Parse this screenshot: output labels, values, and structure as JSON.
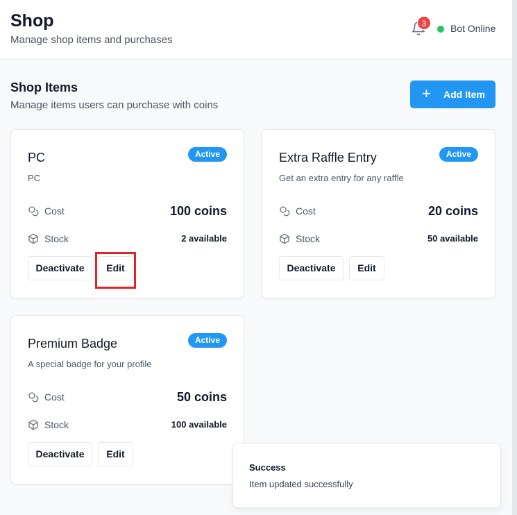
{
  "header": {
    "title": "Shop",
    "subtitle": "Manage shop items and purchases",
    "notification_count": "3",
    "bot_status": "Bot Online",
    "bot_status_color": "#22c55e"
  },
  "section": {
    "title": "Shop Items",
    "subtitle": "Manage items users can purchase with coins",
    "add_button": "Add Item",
    "add_icon": "plus-icon"
  },
  "labels": {
    "cost": "Cost",
    "stock": "Stock"
  },
  "items": [
    {
      "name": "PC",
      "description": "PC",
      "status": "Active",
      "cost": "100 coins",
      "stock": "2 available",
      "deactivate": "Deactivate",
      "edit": "Edit"
    },
    {
      "name": "Extra Raffle Entry",
      "description": "Get an extra entry for any raffle",
      "status": "Active",
      "cost": "20 coins",
      "stock": "50 available",
      "deactivate": "Deactivate",
      "edit": "Edit"
    },
    {
      "name": "Premium Badge",
      "description": "A special badge for your profile",
      "status": "Active",
      "cost": "50 coins",
      "stock": "100 available",
      "deactivate": "Deactivate",
      "edit": "Edit"
    }
  ],
  "toast": {
    "title": "Success",
    "message": "Item updated successfully"
  },
  "colors": {
    "accent": "#2196f3",
    "notification_badge": "#ef4444",
    "highlight": "#dc2626"
  }
}
